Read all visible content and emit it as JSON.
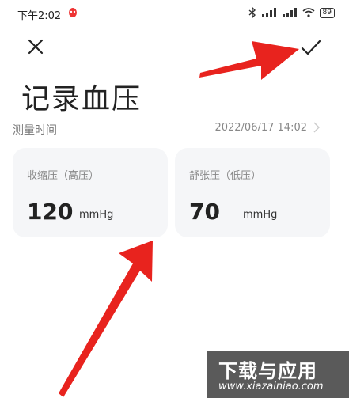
{
  "status_bar": {
    "time": "下午2:02",
    "battery": "89"
  },
  "header": {
    "title": "记录血压"
  },
  "measure_time": {
    "label": "测量时间",
    "value": "2022/06/17 14:02"
  },
  "systolic": {
    "label": "收缩压（高压）",
    "value": "120",
    "unit": "mmHg"
  },
  "diastolic": {
    "label": "舒张压（低压）",
    "value": "70",
    "unit": "mmHg"
  },
  "watermark": {
    "title": "下载与应用",
    "url": "www.xiazainiao.com"
  },
  "colors": {
    "arrow": "#e8231e",
    "card_bg": "#f5f6f8",
    "watermark_bg": "#5a5a5a"
  },
  "icons": [
    "close-icon",
    "check-icon",
    "chevron-right-icon",
    "bluetooth-icon",
    "signal-icon",
    "wifi-icon",
    "battery-icon",
    "notification-icon"
  ]
}
